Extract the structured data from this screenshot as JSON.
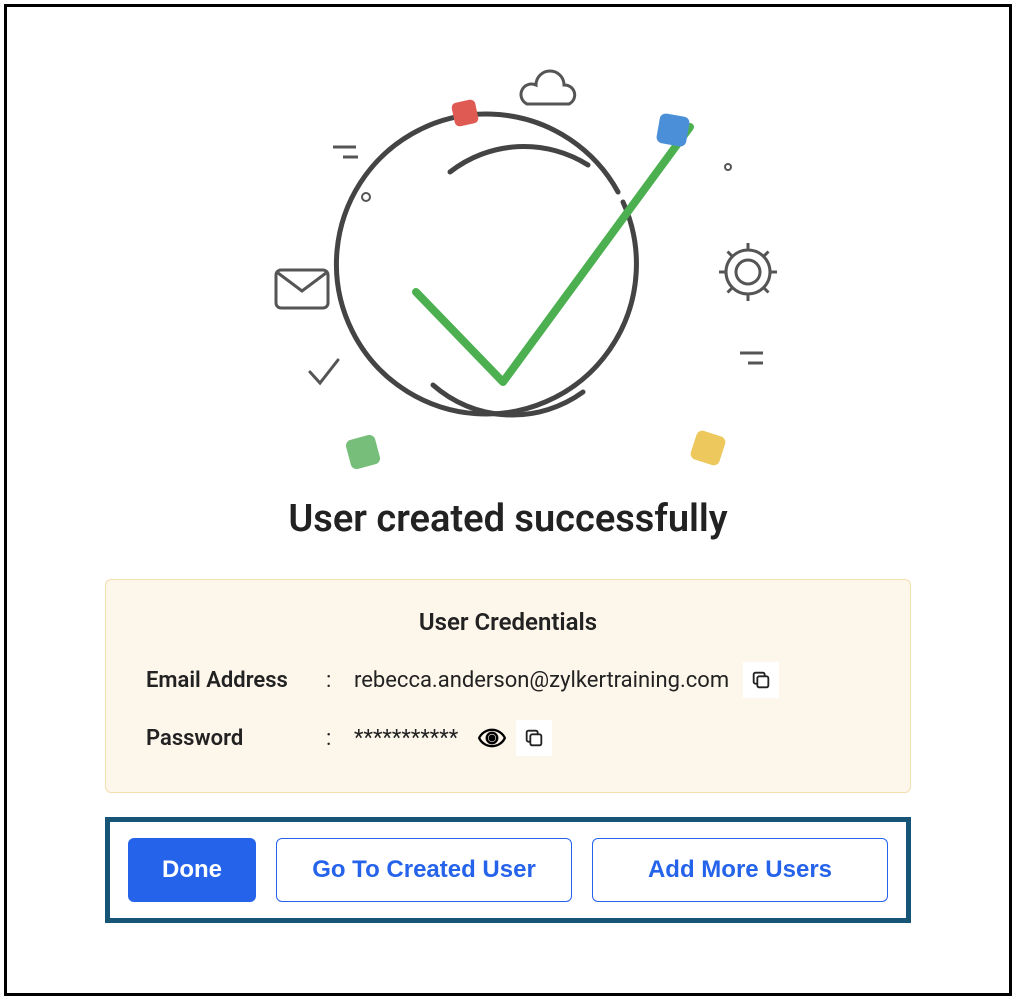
{
  "title": "User created successfully",
  "credentials": {
    "heading": "User Credentials",
    "email_label": "Email Address",
    "email_value": "rebecca.anderson@zylkertraining.com",
    "password_label": "Password",
    "password_value": "***********",
    "colon": ":"
  },
  "buttons": {
    "done": "Done",
    "goto_user": "Go To Created User",
    "add_more": "Add More Users"
  },
  "colors": {
    "primary_blue": "#2563eb",
    "outline_dark_blue": "#175577",
    "card_bg": "#fdf6ea",
    "card_border": "#f3dfb0",
    "illustration_green": "#4cb050",
    "illustration_red": "#df5a53",
    "illustration_blue": "#4a8fd8",
    "illustration_yellow": "#ecc85d"
  }
}
